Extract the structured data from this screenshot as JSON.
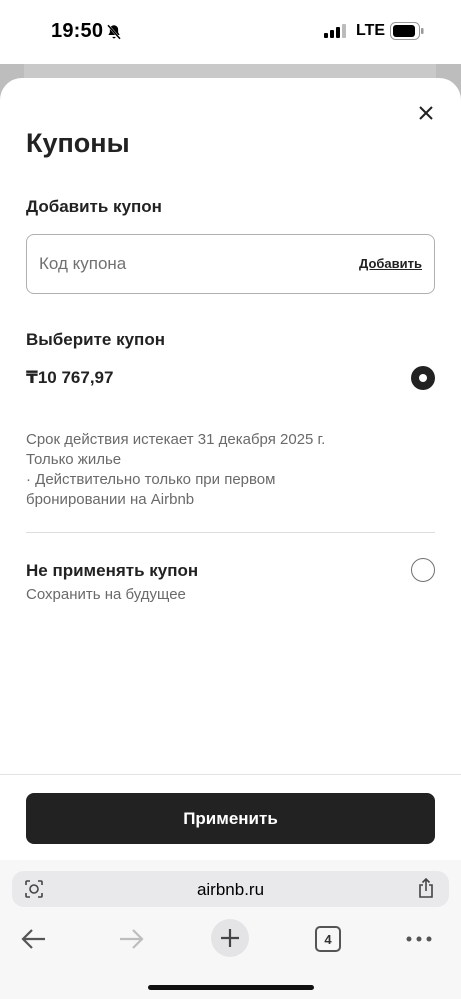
{
  "status_bar": {
    "time": "19:50",
    "network": "LTE",
    "icons": [
      "bell-slash-icon",
      "signal-icon",
      "battery-icon"
    ]
  },
  "sheet": {
    "title": "Купоны",
    "close_icon": "close-icon",
    "add_section": {
      "label": "Добавить купон",
      "input_placeholder": "Код купона",
      "input_value": "",
      "add_link": "Добавить"
    },
    "choose_section": {
      "label": "Выберите купон",
      "coupon": {
        "amount": "₸10 767,97",
        "selected": true,
        "details": [
          "Срок действия истекает 31 декабря 2025 г.",
          "Только жилье",
          " · Действительно только при первом",
          "бронировании на Airbnb"
        ]
      },
      "no_coupon": {
        "title": "Не применять купон",
        "subtitle": "Сохранить на будущее",
        "selected": false
      }
    },
    "apply_button": "Применить"
  },
  "browser": {
    "url": "airbnb.ru",
    "tab_count": "4",
    "icons": [
      "page-settings-icon",
      "share-icon",
      "back-arrow-icon",
      "forward-arrow-icon",
      "plus-icon",
      "tabs-icon",
      "more-icon"
    ]
  },
  "colors": {
    "text_primary": "#222222",
    "text_secondary": "#6a6a6a",
    "button_bg": "#222222",
    "button_text": "#ffffff"
  }
}
